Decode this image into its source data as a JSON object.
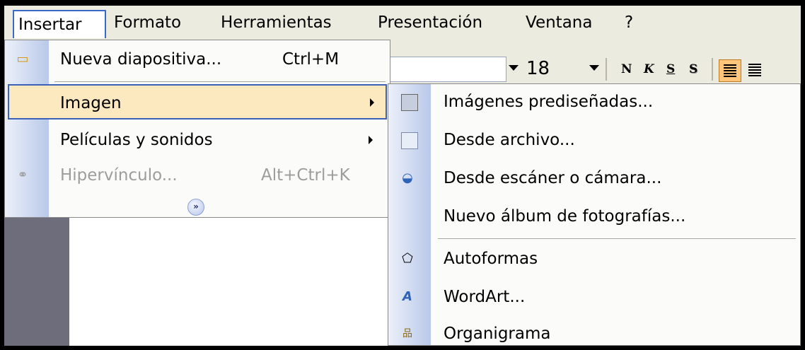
{
  "menubar": {
    "items": [
      "Insertar",
      "Formato",
      "Herramientas",
      "Presentación",
      "Ventana",
      "?"
    ]
  },
  "toolbar": {
    "font_size": "18",
    "format_buttons": [
      "N",
      "K",
      "S",
      "S"
    ]
  },
  "insertar_menu": {
    "items": [
      {
        "label": "Nueva diapositiva...",
        "shortcut": "Ctrl+M",
        "icon": "new-slide-icon"
      },
      {
        "label": "Imagen",
        "submenu": true
      },
      {
        "label": "Películas y sonidos",
        "submenu": true
      },
      {
        "label": "Hipervínculo...",
        "shortcut": "Alt+Ctrl+K",
        "disabled": true,
        "icon": "hyperlink-icon"
      }
    ],
    "expand_icon": "double-chevron-down-icon"
  },
  "imagen_submenu": {
    "items": [
      {
        "label": "Imágenes prediseñadas...",
        "icon": "clipart-icon"
      },
      {
        "label": "Desde archivo...",
        "icon": "picture-file-icon"
      },
      {
        "label": "Desde escáner o cámara...",
        "icon": "scanner-camera-icon"
      },
      {
        "label": "Nuevo álbum de fotografías..."
      },
      {
        "label": "Autoformas",
        "icon": "autoshapes-icon"
      },
      {
        "label": "WordArt...",
        "icon": "wordart-icon"
      },
      {
        "label": "Organigrama",
        "icon": "org-chart-icon"
      }
    ]
  },
  "colors": {
    "menubar_bg": "#ecebe0",
    "highlight_bg": "#fde9c0",
    "highlight_border": "#3b62b8",
    "disabled_text": "#9d9d9d",
    "slide_pane": "#6d6d7c"
  }
}
